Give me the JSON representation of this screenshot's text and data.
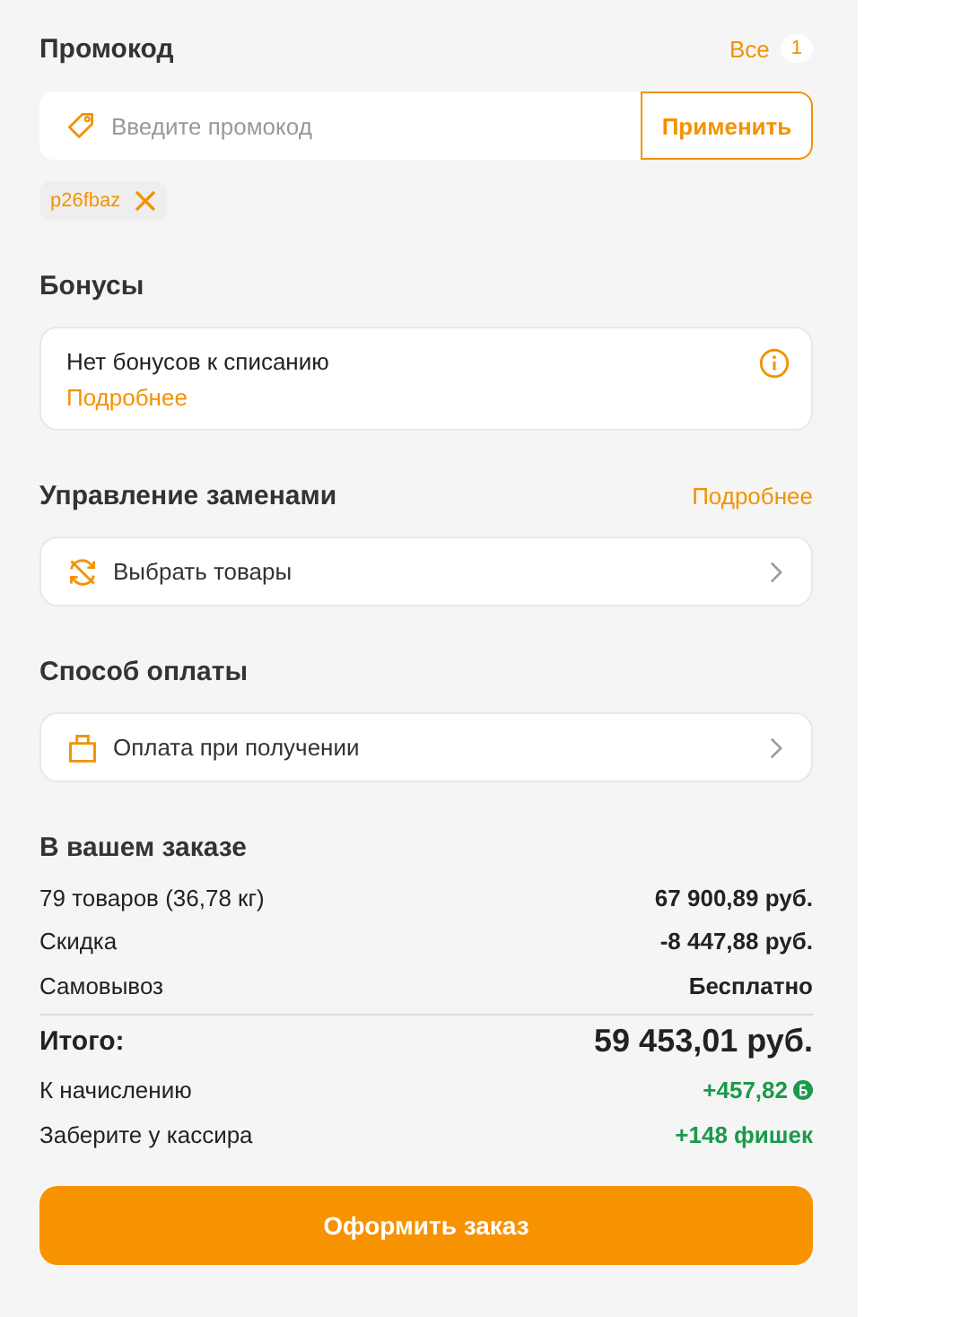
{
  "promo": {
    "title": "Промокод",
    "all_link": "Все",
    "all_count": "1",
    "placeholder": "Введите промокод",
    "apply": "Применить",
    "codes": [
      {
        "code": "p26fbaz"
      }
    ]
  },
  "bonuses": {
    "title": "Бонусы",
    "text": "Нет бонусов к списанию",
    "link": "Подробнее"
  },
  "replacements": {
    "title": "Управление заменами",
    "link": "Подробнее",
    "action": "Выбрать товары"
  },
  "payment": {
    "title": "Способ оплаты",
    "method": "Оплата при получении"
  },
  "order": {
    "title": "В вашем заказе",
    "rows": [
      {
        "kind": "normal",
        "label": "79 товаров (36,78 кг)",
        "value": "67 900,89 руб."
      },
      {
        "kind": "normal",
        "label": "Скидка",
        "value": "-8 447,88 руб."
      },
      {
        "kind": "normal",
        "label": "Самовывоз",
        "value": "Бесплатно"
      },
      {
        "kind": "total",
        "label": "Итого:",
        "value": "59 453,01 руб."
      },
      {
        "kind": "bonus",
        "label": "К начислению",
        "value": "+457,82",
        "coin": true
      },
      {
        "kind": "bonus",
        "label": "Заберите у кассира",
        "value": "+148 фишек",
        "coin": false
      }
    ]
  },
  "checkout": "Оформить заказ"
}
